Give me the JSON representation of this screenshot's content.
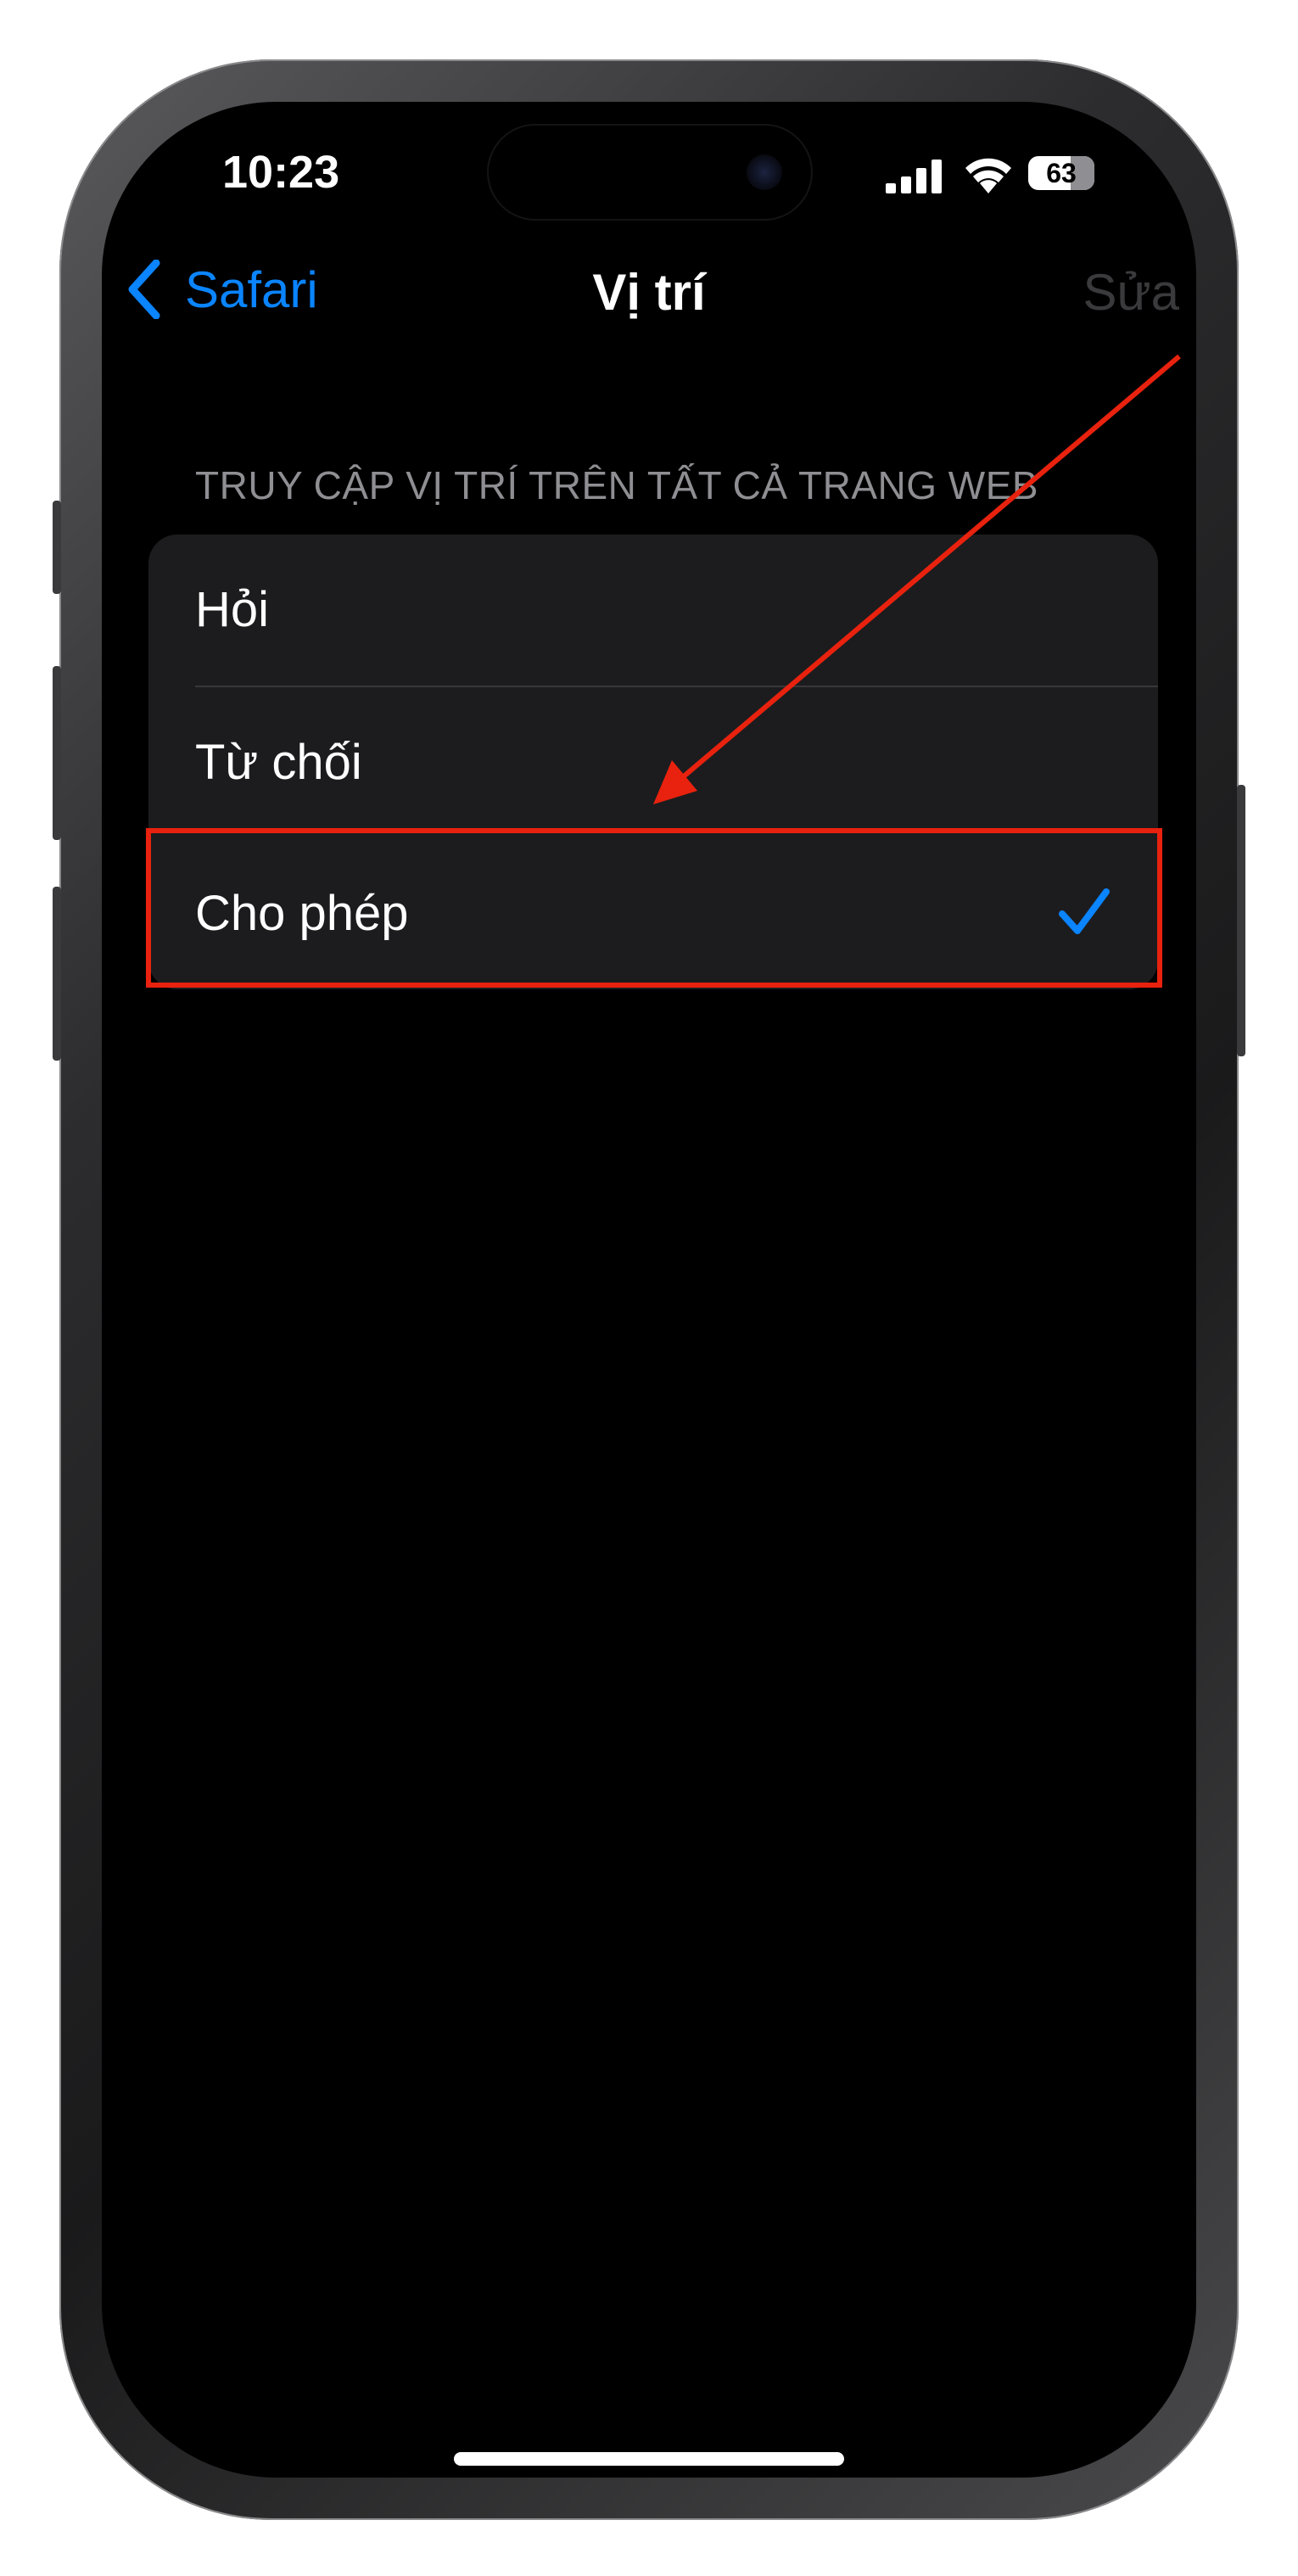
{
  "status_bar": {
    "time": "10:23",
    "battery": "63",
    "signal_icon": "cellular-signal-icon",
    "wifi_icon": "wifi-icon"
  },
  "nav": {
    "back_label": "Safari",
    "back_icon": "chevron-left-icon",
    "title": "Vị trí",
    "edit_label": "Sửa"
  },
  "section": {
    "header": "TRUY CẬP VỊ TRÍ TRÊN TẤT CẢ TRANG WEB",
    "options": [
      {
        "label": "Hỏi",
        "selected": false
      },
      {
        "label": "Từ chối",
        "selected": false
      },
      {
        "label": "Cho phép",
        "selected": true
      }
    ]
  },
  "colors": {
    "accent": "#0a84ff",
    "annotation": "#e8220e",
    "background": "#000000",
    "group_background": "#1c1c1e"
  }
}
